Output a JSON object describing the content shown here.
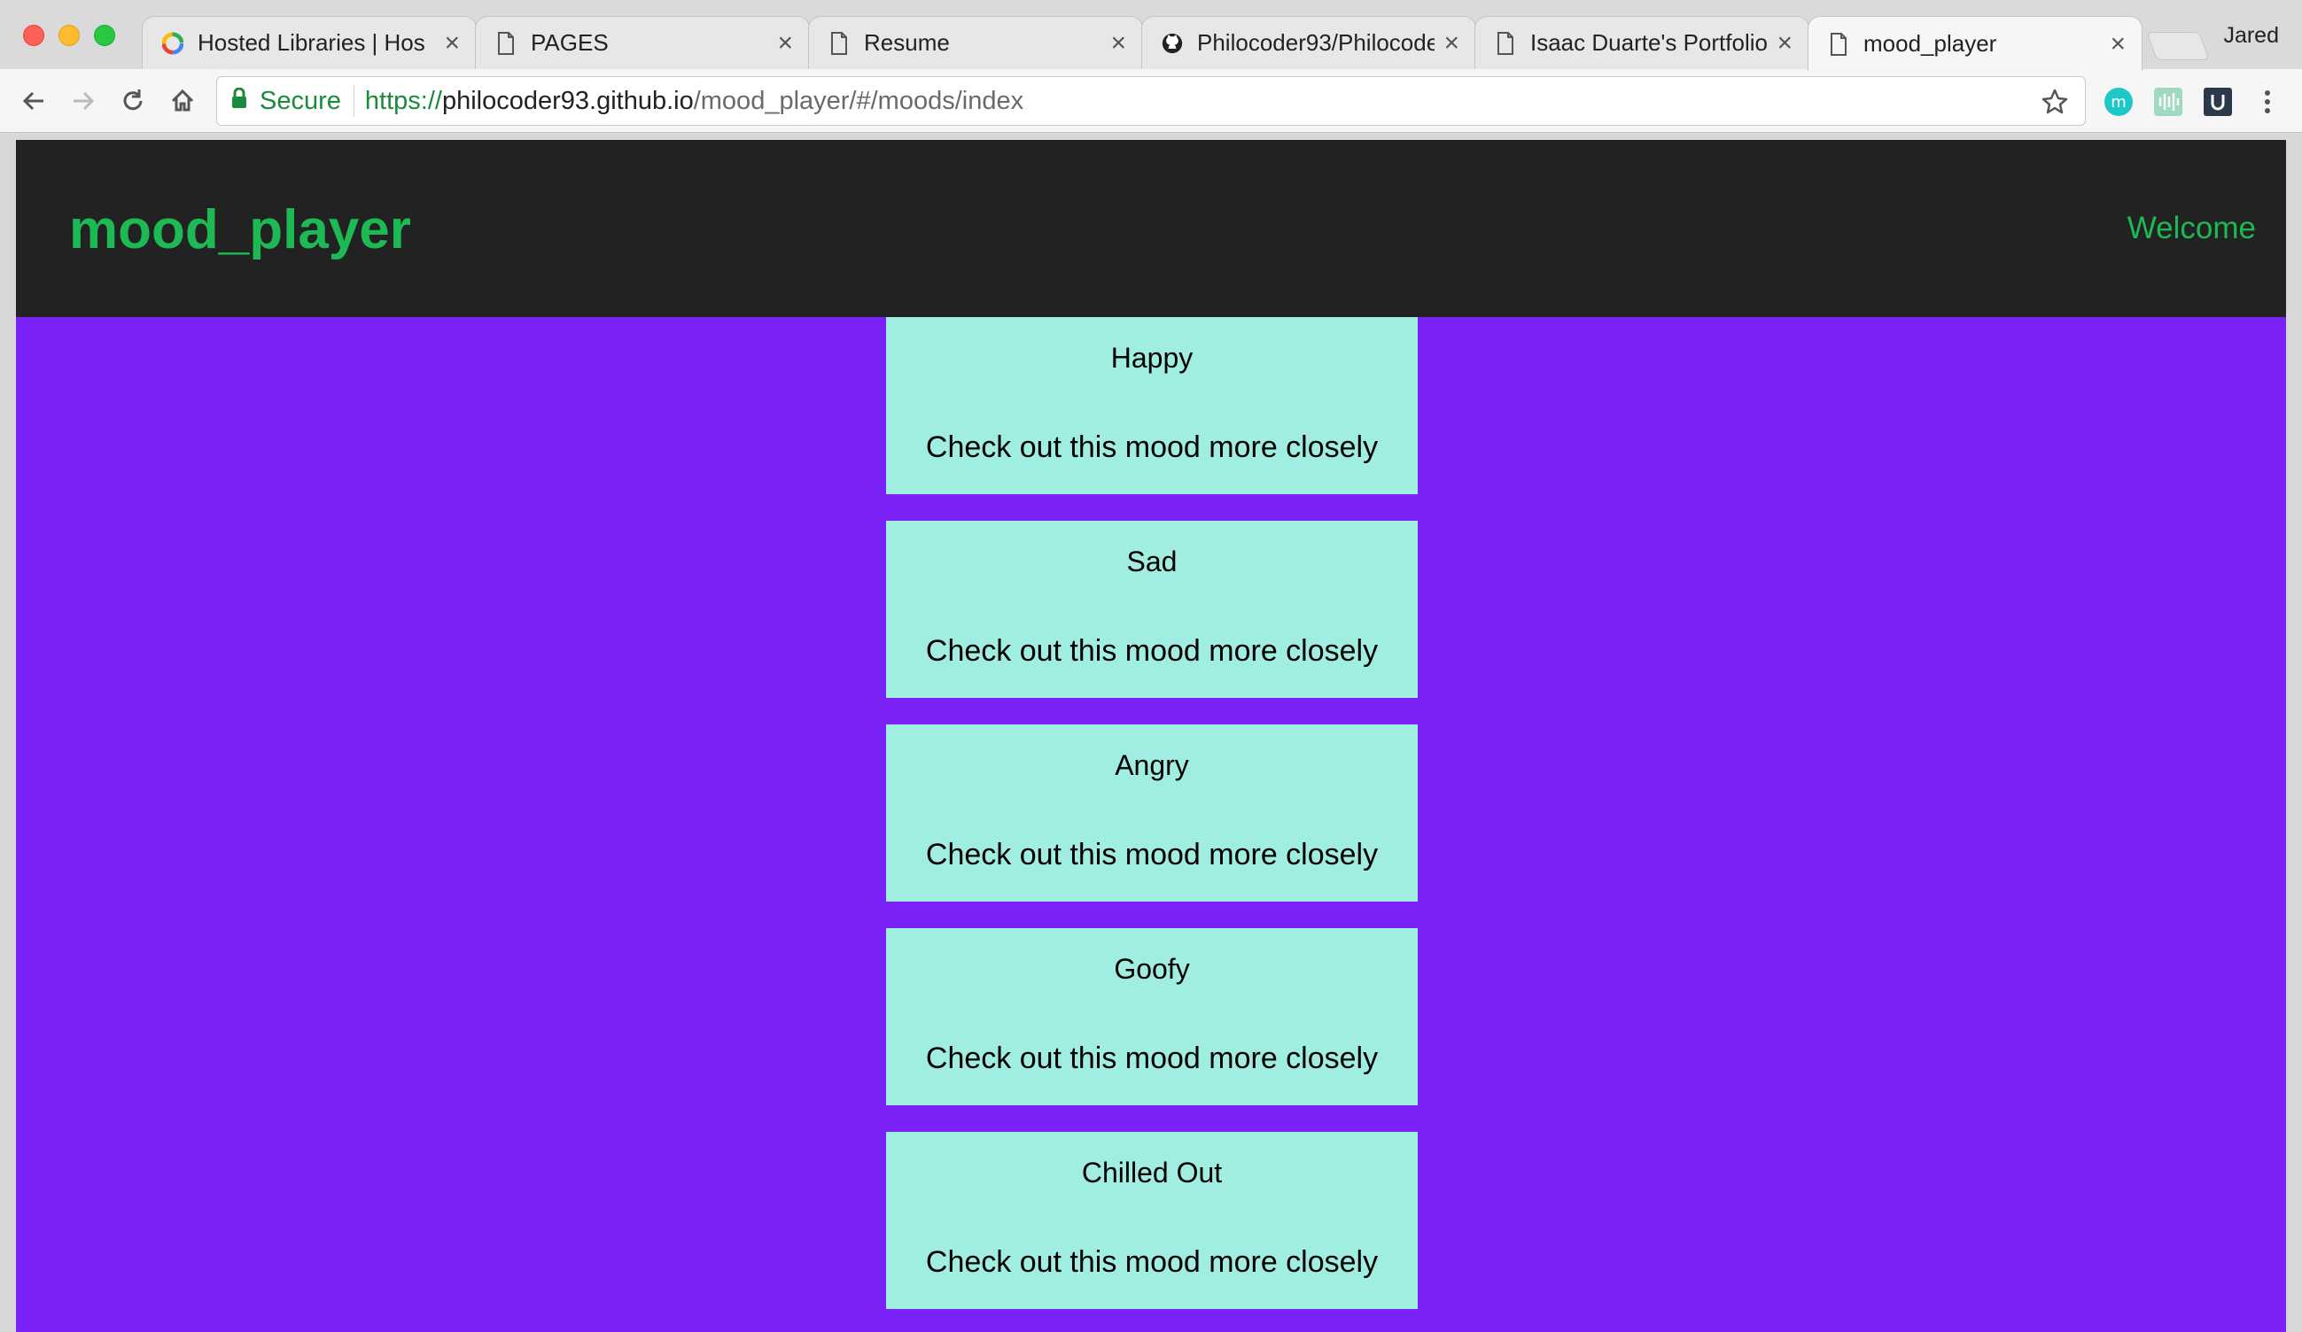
{
  "browser": {
    "tabs": [
      {
        "title": "Hosted Libraries  |  Hos",
        "icon": "google-icon",
        "active": false
      },
      {
        "title": "PAGES",
        "icon": "page-icon",
        "active": false
      },
      {
        "title": "Resume",
        "icon": "page-icon",
        "active": false
      },
      {
        "title": "Philocoder93/Philocode",
        "icon": "github-icon",
        "active": false
      },
      {
        "title": "Isaac Duarte's Portfolio",
        "icon": "page-icon",
        "active": false
      },
      {
        "title": "mood_player",
        "icon": "page-icon",
        "active": true
      }
    ],
    "profile_name": "Jared",
    "secure_label": "Secure",
    "url": {
      "scheme": "https://",
      "host": "philocoder93.github.io",
      "path": "/mood_player/#/moods/index"
    },
    "colors": {
      "secure_green": "#1a8a3b"
    }
  },
  "site": {
    "brand": "mood_player",
    "nav_welcome": "Welcome",
    "colors": {
      "header_bg": "#222222",
      "accent_green": "#1db954",
      "page_bg": "#7a22f8",
      "card_bg": "#a0ede1"
    },
    "moods": [
      {
        "name": "Happy",
        "link": "Check out this mood more closely"
      },
      {
        "name": "Sad",
        "link": "Check out this mood more closely"
      },
      {
        "name": "Angry",
        "link": "Check out this mood more closely"
      },
      {
        "name": "Goofy",
        "link": "Check out this mood more closely"
      },
      {
        "name": "Chilled Out",
        "link": "Check out this mood more closely"
      }
    ]
  }
}
